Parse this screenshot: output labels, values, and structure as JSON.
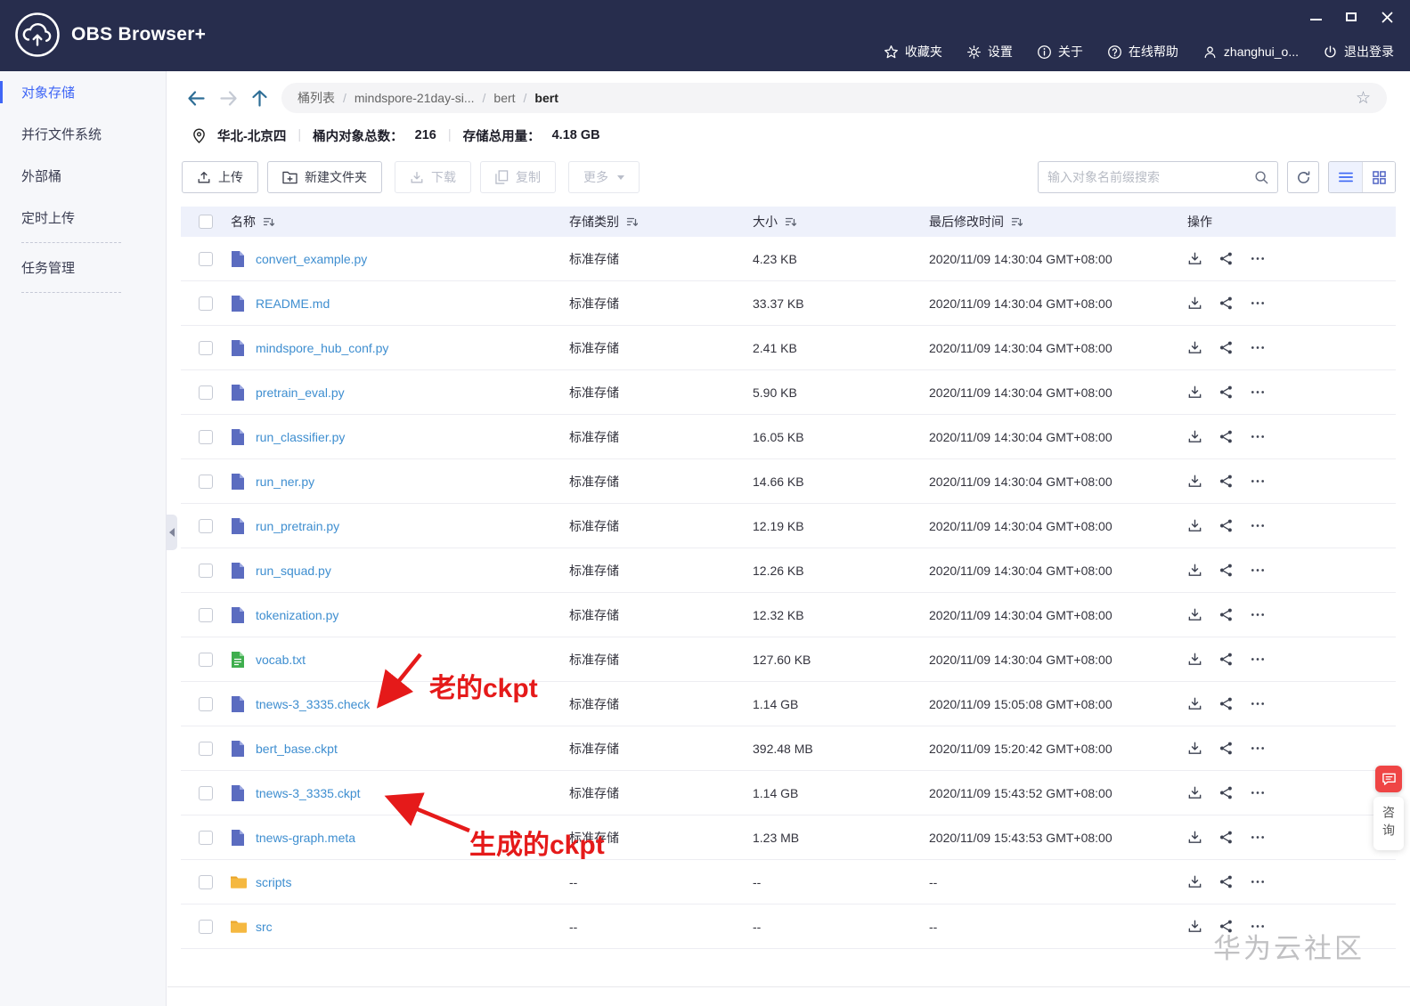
{
  "titlebar": {
    "app_name": "OBS Browser+",
    "menu": [
      {
        "icon": "star-icon",
        "label": "收藏夹"
      },
      {
        "icon": "gear-icon",
        "label": "设置"
      },
      {
        "icon": "info-icon",
        "label": "关于"
      },
      {
        "icon": "help-icon",
        "label": "在线帮助"
      },
      {
        "icon": "user-icon",
        "label": "zhanghui_o..."
      },
      {
        "icon": "power-icon",
        "label": "退出登录"
      }
    ]
  },
  "sidebar": {
    "items": [
      {
        "label": "对象存储",
        "active": true
      },
      {
        "label": "并行文件系统",
        "active": false
      },
      {
        "label": "外部桶",
        "active": false
      },
      {
        "label": "定时上传",
        "active": false
      },
      {
        "label": "任务管理",
        "active": false
      }
    ]
  },
  "nav": {
    "breadcrumb": [
      "桶列表",
      "mindspore-21day-si...",
      "bert",
      "bert"
    ],
    "sep": "/"
  },
  "icons": {
    "star_outline": "☆"
  },
  "infobar": {
    "region": "华北-北京四",
    "divider": "|",
    "objects_label": "桶内对象总数：",
    "objects_count": "216",
    "storage_label": "存储总用量：",
    "storage_value": "4.18 GB"
  },
  "toolbar": {
    "upload": "上传",
    "new_folder": "新建文件夹",
    "download": "下载",
    "copy": "复制",
    "more": "更多",
    "search_placeholder": "输入对象名前缀搜索"
  },
  "table": {
    "headers": {
      "name": "名称",
      "storage_class": "存储类别",
      "size": "大小",
      "modified": "最后修改时间",
      "actions": "操作"
    },
    "rows": [
      {
        "name": "convert_example.py",
        "icon": "file",
        "storage_class": "标准存储",
        "size": "4.23 KB",
        "modified": "2020/11/09 14:30:04 GMT+08:00"
      },
      {
        "name": "README.md",
        "icon": "file",
        "storage_class": "标准存储",
        "size": "33.37 KB",
        "modified": "2020/11/09 14:30:04 GMT+08:00"
      },
      {
        "name": "mindspore_hub_conf.py",
        "icon": "file",
        "storage_class": "标准存储",
        "size": "2.41 KB",
        "modified": "2020/11/09 14:30:04 GMT+08:00"
      },
      {
        "name": "pretrain_eval.py",
        "icon": "file",
        "storage_class": "标准存储",
        "size": "5.90 KB",
        "modified": "2020/11/09 14:30:04 GMT+08:00"
      },
      {
        "name": "run_classifier.py",
        "icon": "file",
        "storage_class": "标准存储",
        "size": "16.05 KB",
        "modified": "2020/11/09 14:30:04 GMT+08:00"
      },
      {
        "name": "run_ner.py",
        "icon": "file",
        "storage_class": "标准存储",
        "size": "14.66 KB",
        "modified": "2020/11/09 14:30:04 GMT+08:00"
      },
      {
        "name": "run_pretrain.py",
        "icon": "file",
        "storage_class": "标准存储",
        "size": "12.19 KB",
        "modified": "2020/11/09 14:30:04 GMT+08:00"
      },
      {
        "name": "run_squad.py",
        "icon": "file",
        "storage_class": "标准存储",
        "size": "12.26 KB",
        "modified": "2020/11/09 14:30:04 GMT+08:00"
      },
      {
        "name": "tokenization.py",
        "icon": "file",
        "storage_class": "标准存储",
        "size": "12.32 KB",
        "modified": "2020/11/09 14:30:04 GMT+08:00"
      },
      {
        "name": "vocab.txt",
        "icon": "txt",
        "storage_class": "标准存储",
        "size": "127.60 KB",
        "modified": "2020/11/09 14:30:04 GMT+08:00"
      },
      {
        "name": "tnews-3_3335.check",
        "icon": "file",
        "storage_class": "标准存储",
        "size": "1.14 GB",
        "modified": "2020/11/09 15:05:08 GMT+08:00"
      },
      {
        "name": "bert_base.ckpt",
        "icon": "file",
        "storage_class": "标准存储",
        "size": "392.48 MB",
        "modified": "2020/11/09 15:20:42 GMT+08:00"
      },
      {
        "name": "tnews-3_3335.ckpt",
        "icon": "file",
        "storage_class": "标准存储",
        "size": "1.14 GB",
        "modified": "2020/11/09 15:43:52 GMT+08:00"
      },
      {
        "name": "tnews-graph.meta",
        "icon": "file",
        "storage_class": "标准存储",
        "size": "1.23 MB",
        "modified": "2020/11/09 15:43:53 GMT+08:00"
      },
      {
        "name": "scripts",
        "icon": "folder",
        "storage_class": "--",
        "size": "--",
        "modified": "--"
      },
      {
        "name": "src",
        "icon": "folder",
        "storage_class": "--",
        "size": "--",
        "modified": "--"
      }
    ]
  },
  "annotations": {
    "old_ckpt": "老的ckpt",
    "new_ckpt": "生成的ckpt"
  },
  "chat": {
    "label": "咨询"
  },
  "watermark": "华为云社区"
}
